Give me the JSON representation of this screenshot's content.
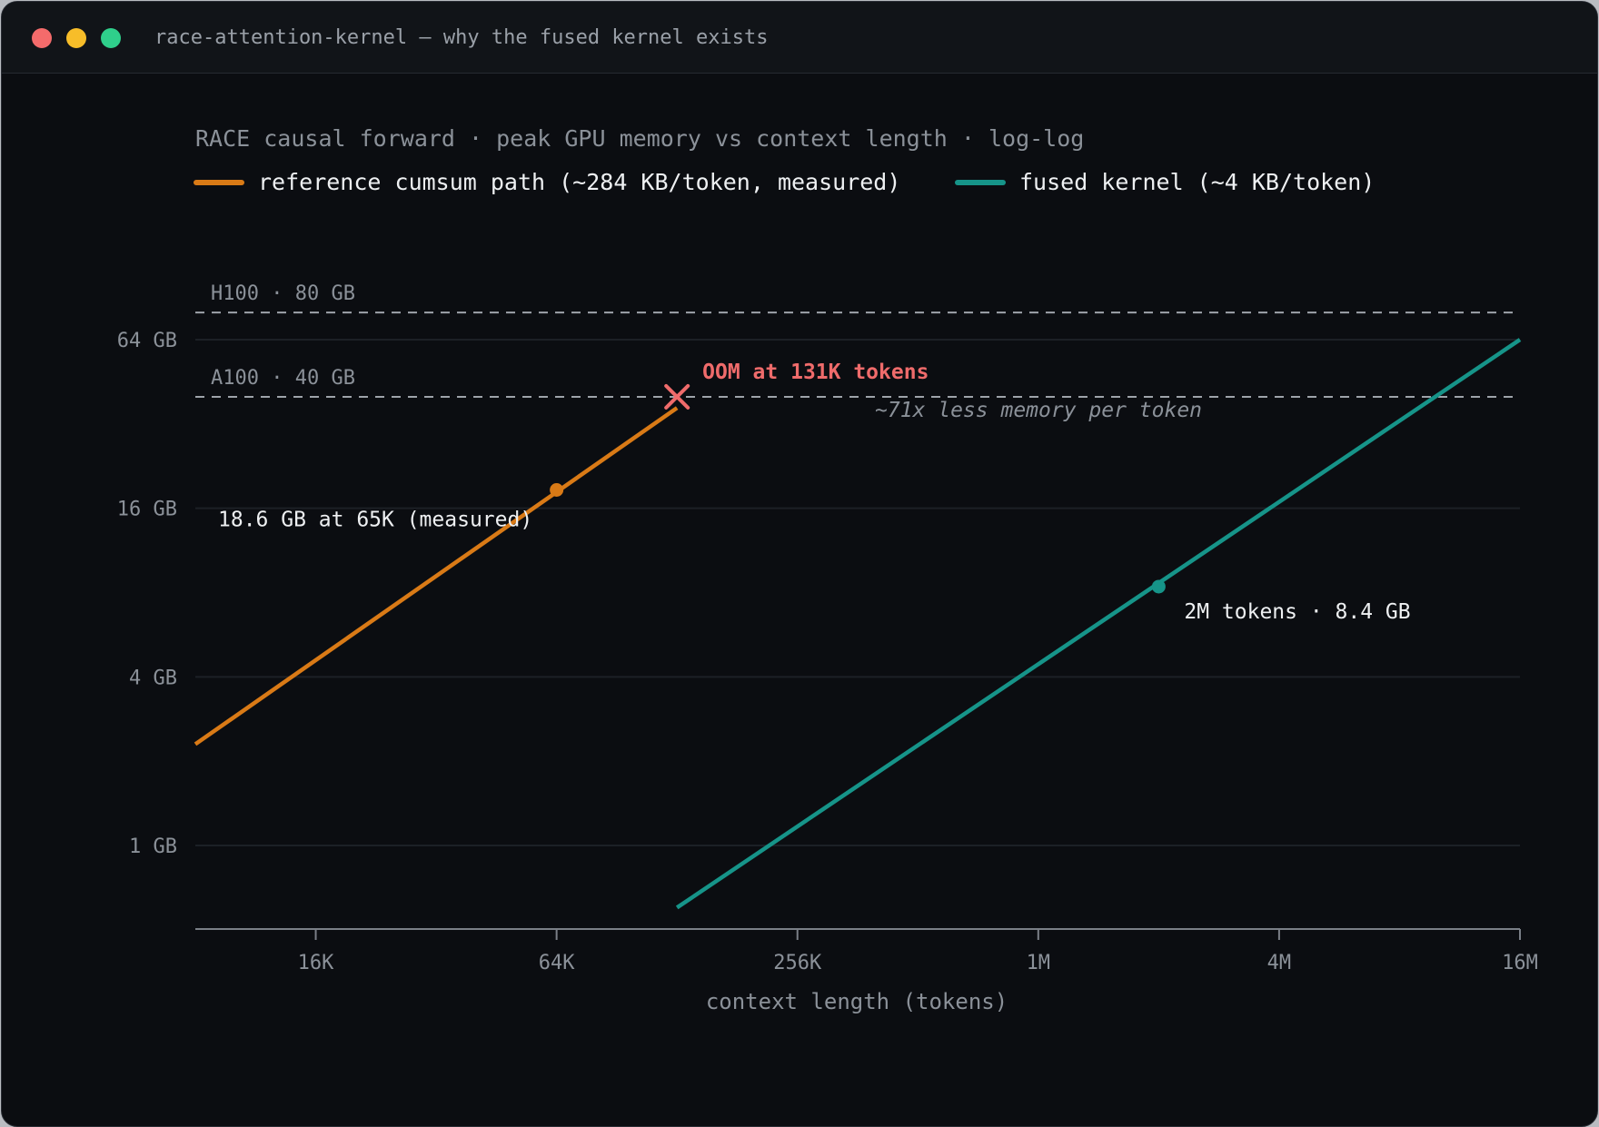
{
  "window": {
    "title": "race-attention-kernel — why the fused kernel exists",
    "traffic_lights": {
      "close": "#f46b6b",
      "minimize": "#f7bd29",
      "zoom": "#2fcf8b"
    }
  },
  "colors": {
    "reference": "#d97a16",
    "fused": "#169489",
    "oom": "#ef6b6b",
    "text": "#eef0f2",
    "muted": "#8b9199",
    "grid": "#1c2026",
    "axis": "#7a7f87"
  },
  "chart_data": {
    "type": "line",
    "title": "RACE causal forward · peak GPU memory vs context length · log-log",
    "xlabel": "context length (tokens)",
    "ylabel": "",
    "x_scale": "log",
    "y_scale": "log",
    "xlim": [
      8192,
      16777216
    ],
    "ylim": [
      0.6,
      64
    ],
    "grid": true,
    "legend_position": "top-left",
    "x_ticks": [
      {
        "value": 16384,
        "label": "16K"
      },
      {
        "value": 65536,
        "label": "64K"
      },
      {
        "value": 262144,
        "label": "256K"
      },
      {
        "value": 1048576,
        "label": "1M"
      },
      {
        "value": 4194304,
        "label": "4M"
      },
      {
        "value": 16777216,
        "label": "16M"
      }
    ],
    "y_ticks": [
      {
        "value": 1,
        "label": "1 GB"
      },
      {
        "value": 4,
        "label": "4 GB"
      },
      {
        "value": 16,
        "label": "16 GB"
      },
      {
        "value": 64,
        "label": "64 GB"
      }
    ],
    "series": [
      {
        "name": "reference cumsum path (~284 KB/token, measured)",
        "color": "#d97a16",
        "x": [
          8192,
          131072
        ],
        "y": [
          2.3,
          36.5
        ]
      },
      {
        "name": "fused kernel (~4 KB/token)",
        "color": "#169489",
        "x": [
          131072,
          16777216
        ],
        "y": [
          0.6,
          64
        ]
      }
    ],
    "reference_lines": [
      {
        "label": "H100 · 80 GB",
        "y": 80
      },
      {
        "label": "A100 · 40 GB",
        "y": 40
      }
    ],
    "points": [
      {
        "series": 0,
        "x": 65536,
        "y": 18.6,
        "label": "18.6 GB at 65K (measured)"
      },
      {
        "series": 1,
        "x": 2097152,
        "y": 8.4,
        "label": "2M tokens · 8.4 GB"
      }
    ],
    "annotations": {
      "oom": {
        "x": 131072,
        "y": 40,
        "label": "OOM at 131K tokens"
      },
      "ratio": "~71x less memory per token"
    }
  }
}
